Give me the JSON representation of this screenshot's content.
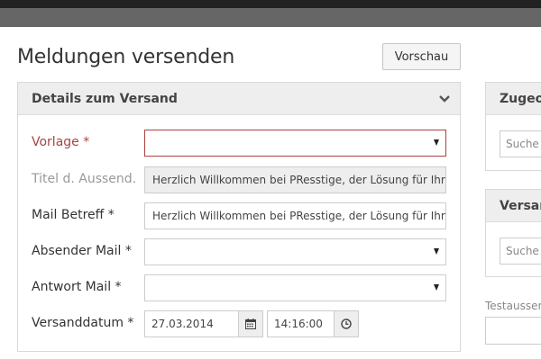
{
  "page": {
    "title": "Meldungen versenden"
  },
  "toolbar": {
    "preview_label": "Vorschau"
  },
  "details": {
    "title": "Details zum Versand",
    "fields": {
      "vorlage": {
        "label": "Vorlage *",
        "value": ""
      },
      "titel": {
        "label": "Titel d. Aussend.",
        "value": "Herzlich Willkommen bei PResstige, der Lösung für Ihre"
      },
      "betreff": {
        "label": "Mail Betreff *",
        "value": "Herzlich Willkommen bei PResstige, der Lösung für Ihre"
      },
      "absender": {
        "label": "Absender Mail *",
        "value": ""
      },
      "antwort": {
        "label": "Antwort Mail *",
        "value": ""
      },
      "versanddatum": {
        "label": "Versanddatum *",
        "date": "27.03.2014",
        "time": "14:16:00"
      }
    }
  },
  "side": {
    "zugeordnet": {
      "title": "Zugeor",
      "search_placeholder": "Suche n"
    },
    "versand": {
      "title": "Versan",
      "search_placeholder": "Suche n"
    },
    "testaussendung": {
      "label": "Testaussen"
    }
  },
  "colors": {
    "error": "#a94442",
    "panel_header": "#eeeeee",
    "topbar": "#666666"
  }
}
